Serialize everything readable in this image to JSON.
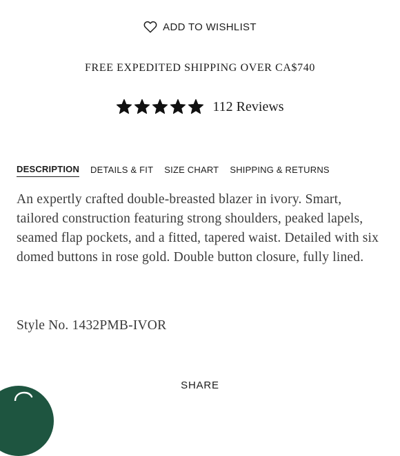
{
  "wishlist": {
    "icon": "heart-outline-icon",
    "label": "ADD TO WISHLIST"
  },
  "shipping_note": "FREE EXPEDITED SHIPPING OVER CA$740",
  "rating": {
    "stars": 5,
    "max_stars": 5,
    "star_color": "#111111",
    "reviews_label": "112 Reviews"
  },
  "tabs": [
    {
      "label": "DESCRIPTION",
      "active": true
    },
    {
      "label": "DETAILS & FIT",
      "active": false
    },
    {
      "label": "SIZE CHART",
      "active": false
    },
    {
      "label": "SHIPPING & RETURNS",
      "active": false
    }
  ],
  "description": "An expertly crafted double-breasted blazer in ivory. Smart, tailored construction featuring strong shoulders, peaked lapels, seamed flap pockets, and a fitted, tapered waist. Detailed with six domed buttons in rose gold. Double button closure, fully lined.",
  "style_number": "Style No. 1432PMB-IVOR",
  "share_label": "SHARE",
  "chat": {
    "icon": "chat-bubble-icon",
    "color": "#1e5540"
  }
}
